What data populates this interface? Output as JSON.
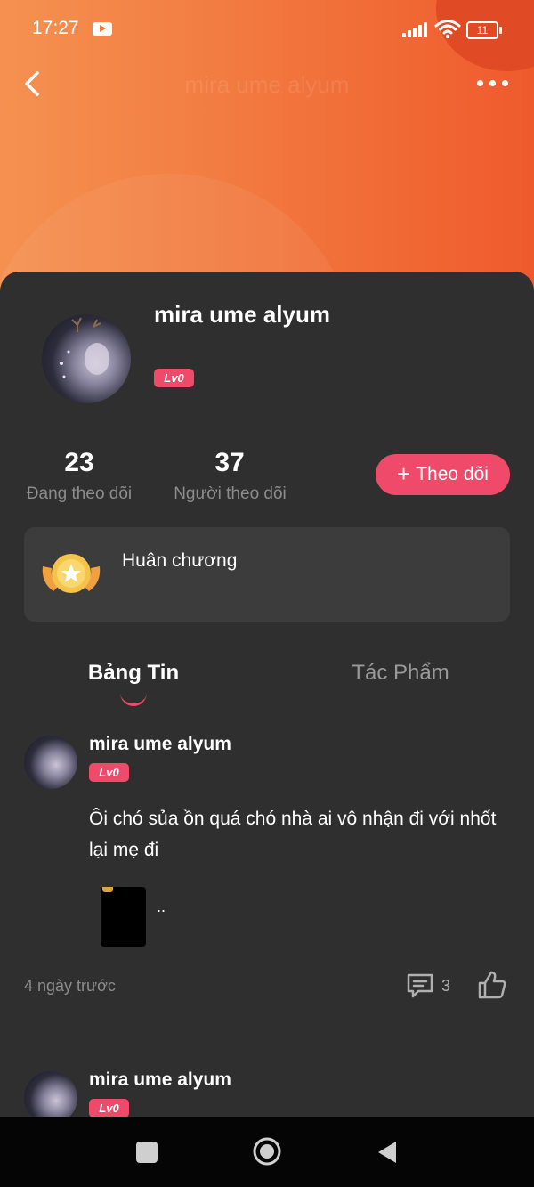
{
  "status_bar": {
    "time": "17:27",
    "battery": "11"
  },
  "header": {
    "title": "mira ume alyum"
  },
  "profile": {
    "name": "mira ume alyum",
    "level": "Lv0",
    "following_count": "23",
    "following_label": "Đang theo dõi",
    "followers_count": "37",
    "followers_label": "Người theo dõi",
    "follow_button": "Theo dõi"
  },
  "medal": {
    "label": "Huân chương"
  },
  "tabs": [
    {
      "label": "Bảng Tin",
      "active": true
    },
    {
      "label": "Tác Phẩm",
      "active": false
    }
  ],
  "posts": [
    {
      "author": "mira ume alyum",
      "level": "Lv0",
      "text": "Ôi chó sủa ồn quá chó nhà ai vô nhận đi với nhốt lại mẹ đi",
      "attachment_caption": "..",
      "time": "4 ngày trước",
      "comments": "3"
    },
    {
      "author": "mira ume alyum",
      "level": "Lv0"
    }
  ],
  "colors": {
    "accent": "#f04a6a",
    "header_gradient_start": "#f59150",
    "header_gradient_end": "#ef5a2c",
    "background": "#2f2f2f",
    "card": "#3c3c3c"
  }
}
